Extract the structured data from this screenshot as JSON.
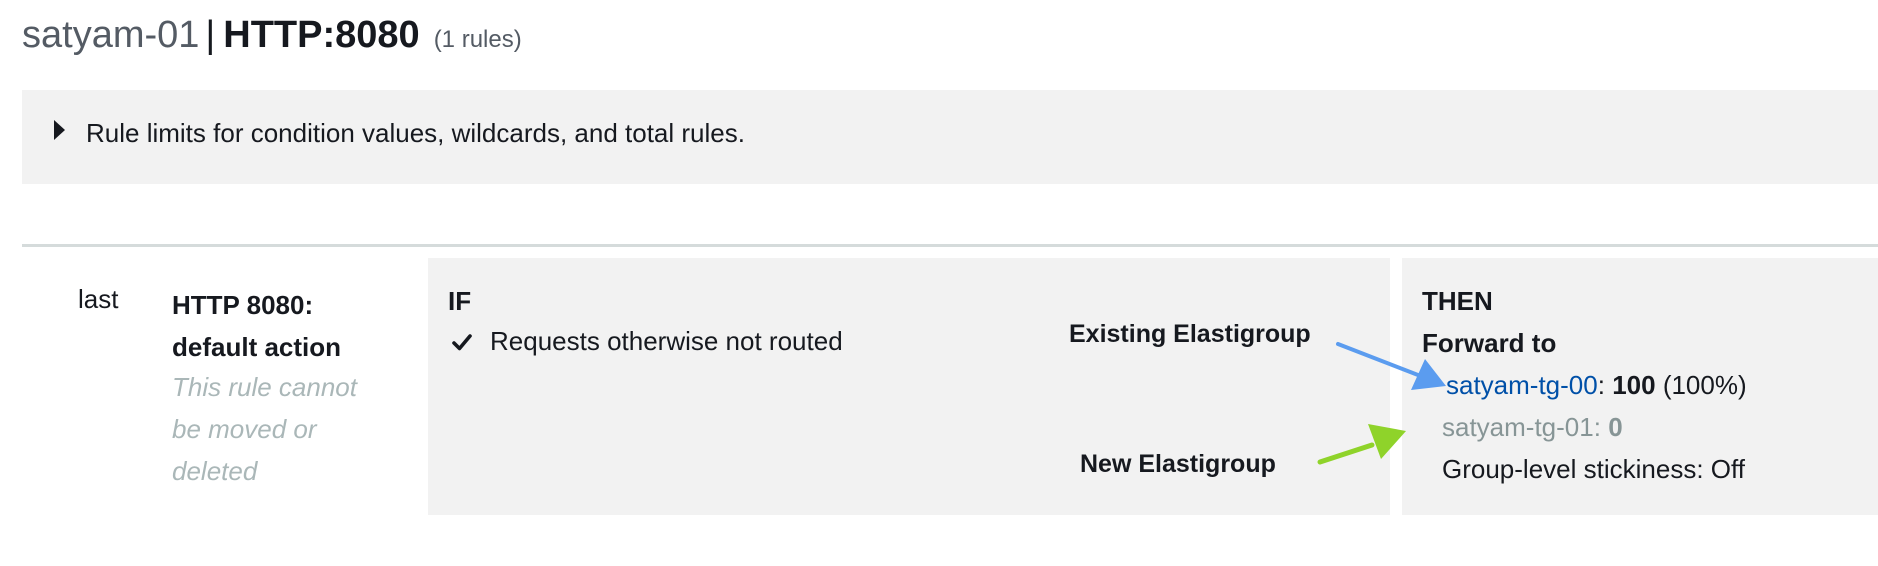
{
  "header": {
    "load_balancer": "satyam-01",
    "separator": "|",
    "listener": "HTTP:8080",
    "rule_count": "(1 rules)"
  },
  "limits": {
    "text": "Rule limits for condition values, wildcards, and total rules."
  },
  "rule": {
    "priority": "last",
    "name": "HTTP 8080: default action",
    "note": "This rule cannot be moved or deleted",
    "if": {
      "heading": "IF",
      "condition": "Requests otherwise not routed"
    },
    "then": {
      "heading": "THEN",
      "action": "Forward to",
      "target_groups": [
        {
          "name": "satyam-tg-00",
          "weight": "100",
          "percent": "(100%)"
        },
        {
          "name": "satyam-tg-01",
          "weight": "0"
        }
      ],
      "stickiness": "Group-level stickiness: Off"
    }
  },
  "annotations": {
    "existing": "Existing Elastigroup",
    "new": "New Elastigroup"
  },
  "colors": {
    "link": "#0050a8",
    "panel_bg": "#f2f2f2",
    "arrow_existing": "#5b9cef",
    "arrow_new": "#8fd32a",
    "muted": "#879596"
  },
  "icons": {
    "expand": "caret-right-icon",
    "check": "checkmark-icon"
  }
}
